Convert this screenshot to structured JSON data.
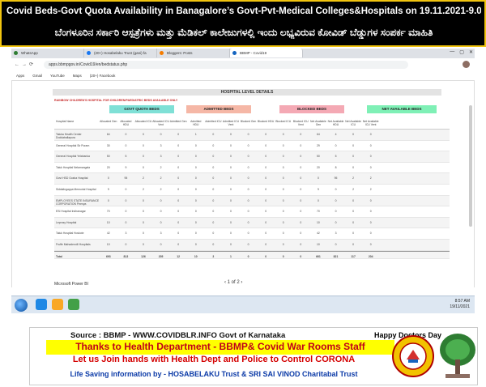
{
  "banner": {
    "title": "Covid Beds-Govt Quota Availability in Banagalore’s Govt-Pvt-Medical Colleges&Hospitals on  19.11.2021-9.00Am",
    "kannada": "ಬೆಂಗಳೂರಿನ ಸರ್ಕಾರಿ ಆಸ್ಪತ್ರೆಗಳು ಮತ್ತು ಮೆಡಿಕಲ್ ಕಾಲೇಜುಗಳಲ್ಲಿ ಇಂದು ಲಭ್ಯವಿರುವ ಕೋವಿಡ್ ಬೆಡ್ಡುಗಳ ಸಂಪರ್ಕ ಮಾಹಿತಿ"
  },
  "browser": {
    "tabs": [
      {
        "label": "WhatsApp"
      },
      {
        "label": "(20+) Hosabelaku Trust (gani) fa"
      },
      {
        "label": "Bloggers: Posts"
      },
      {
        "label": "BBMP - Covid19",
        "active": true
      }
    ],
    "url": "apps.bbmpgov.in/Covid19/en/bedstatus.php",
    "bookmarks": [
      "Apps",
      "Gmail",
      "YouTube",
      "Maps",
      "(20+) Facebook"
    ]
  },
  "page": {
    "heading": "HOSPITAL LEVEL DETAILS",
    "subheading": "RAINBOW CHILDREN'S HOSPITAL FOR CHILDREN/PAEDIATRIC BEDS AVAILABLE ONLY",
    "categories": [
      "GOVT QUOTA BEDS",
      "ADMITTED BEDS",
      "BLOCKED BEDS",
      "NET AVAILABLE BEDS"
    ],
    "columns": [
      "Hospital Name",
      "Allocated Gen",
      "Allocated HDU",
      "Allocated ICU",
      "Allocated ICU Vent",
      "Admitted Gen",
      "Admitted HDU",
      "Admitted ICU",
      "Admitted ICU Vent",
      "Blocked Gen",
      "Blocked HDU",
      "Blocked ICU",
      "Blocked ICU Vent",
      "Net Available Gen",
      "Net Available HDU",
      "Net Available ICU",
      "Net Available ICU Vent"
    ],
    "rows": [
      [
        "Taluka Health Center Doddaballapura",
        "64",
        "0",
        "0",
        "0",
        "0",
        "1",
        "0",
        "0",
        "0",
        "0",
        "0",
        "0",
        "64",
        "4",
        "0",
        "0"
      ],
      [
        "General Hospital Sir Puram",
        "30",
        "0",
        "0",
        "3",
        "0",
        "0",
        "0",
        "0",
        "0",
        "0",
        "0",
        "0",
        "29",
        "0",
        "0",
        "0"
      ],
      [
        "General Hospital Yelahanka",
        "50",
        "5",
        "0",
        "3",
        "0",
        "0",
        "0",
        "0",
        "0",
        "0",
        "0",
        "0",
        "50",
        "5",
        "0",
        "0"
      ],
      [
        "Taluk Hospital Nelamangala",
        "20",
        "9",
        "0",
        "2",
        "0",
        "0",
        "0",
        "0",
        "0",
        "0",
        "0",
        "0",
        "20",
        "8",
        "0",
        "0"
      ],
      [
        "Govt HSD Gosha Hospital",
        "0",
        "95",
        "2",
        "2",
        "0",
        "0",
        "0",
        "0",
        "0",
        "0",
        "0",
        "0",
        "0",
        "95",
        "2",
        "2"
      ],
      [
        "Siddalingappa Memorial Hospital",
        "9",
        "0",
        "2",
        "2",
        "0",
        "0",
        "0",
        "0",
        "0",
        "0",
        "0",
        "0",
        "9",
        "0",
        "2",
        "2"
      ],
      [
        "EMPLOYEES STATE INSURANCE CORPORATION Peenya",
        "0",
        "0",
        "0",
        "0",
        "0",
        "0",
        "0",
        "0",
        "0",
        "0",
        "0",
        "0",
        "0",
        "0",
        "0",
        "0"
      ],
      [
        "ESI Hospital Indiranagar",
        "70",
        "0",
        "0",
        "0",
        "0",
        "0",
        "0",
        "0",
        "0",
        "0",
        "0",
        "0",
        "70",
        "0",
        "0",
        "0"
      ],
      [
        "Leprosy Hospital",
        "10",
        "0",
        "0",
        "0",
        "0",
        "0",
        "0",
        "0",
        "0",
        "0",
        "0",
        "0",
        "10",
        "0",
        "0",
        "0"
      ],
      [
        "Taluk Hospital Hoskote",
        "42",
        "3",
        "0",
        "3",
        "0",
        "0",
        "0",
        "0",
        "0",
        "0",
        "0",
        "0",
        "42",
        "3",
        "0",
        "0"
      ],
      [
        "Fruffe Mahadevolli Hospitals",
        "10",
        "0",
        "0",
        "0",
        "0",
        "0",
        "0",
        "0",
        "0",
        "0",
        "0",
        "0",
        "10",
        "0",
        "0",
        "0"
      ]
    ],
    "totals": [
      "Total",
      "693",
      "813",
      "126",
      "205",
      "12",
      "10",
      "3",
      "1",
      "0",
      "0",
      "0",
      "0",
      "661",
      "821",
      "117",
      "204"
    ],
    "powerbi": "Microsoft Power BI",
    "pager": "1 of 2"
  },
  "taskbar": {
    "time": "8:57 AM",
    "date": "19/11/2021"
  },
  "info": {
    "source": "Source : BBMP - WWW.COVIDBLR.INFO  Govt of Karnataka",
    "happy": "Happy Doctors Day",
    "thanks": "Thanks to Health Department - BBMP& Covid War Rooms Staff",
    "join": "Let us Join hands with Health Dept and Police to Control CORONA",
    "life": "Life Saving information by - HOSABELAKU Trust & SRI SAI VINOD Charitabal Trust"
  },
  "colors": {
    "banner_bg": "#000000",
    "banner_border": "#f1c40f",
    "govt_quota": "#7fe0d6",
    "admitted": "#f5b7a6",
    "blocked": "#f4a9b4",
    "net_available": "#7ff0b6",
    "thanks_bg": "#ffff00",
    "thanks_text": "#c0001a",
    "join_text": "#d40000",
    "life_text": "#0b3aa7"
  }
}
